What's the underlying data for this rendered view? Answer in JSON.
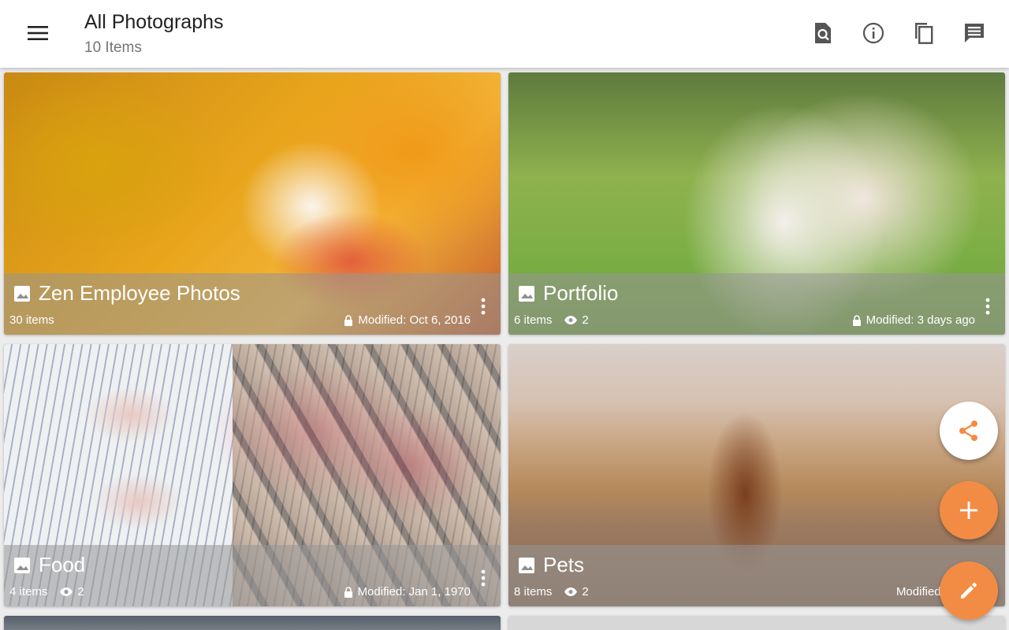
{
  "appbar": {
    "title": "All Photographs",
    "subtitle": "10 Items",
    "actions": [
      "search-document-icon",
      "info-icon",
      "copy-icon",
      "comment-icon"
    ]
  },
  "albums": [
    {
      "title": "Zen Employee Photos",
      "count": "30 items",
      "views": "",
      "modified": "Modified: Oct 6, 2016",
      "locked": true
    },
    {
      "title": "Portfolio",
      "count": "6 items",
      "views": "2",
      "modified": "Modified: 3 days ago",
      "locked": true
    },
    {
      "title": "Food",
      "count": "4 items",
      "views": "2",
      "modified": "Modified: Jan 1, 1970",
      "locked": true
    },
    {
      "title": "Pets",
      "count": "8 items",
      "views": "2",
      "modified": "Modified: Apr 5",
      "locked": false
    }
  ],
  "fabs": [
    "share-icon",
    "add-icon",
    "edit-icon"
  ],
  "colors": {
    "accent": "#f28c45",
    "appbar": "#ffffff",
    "background": "#ececec"
  }
}
